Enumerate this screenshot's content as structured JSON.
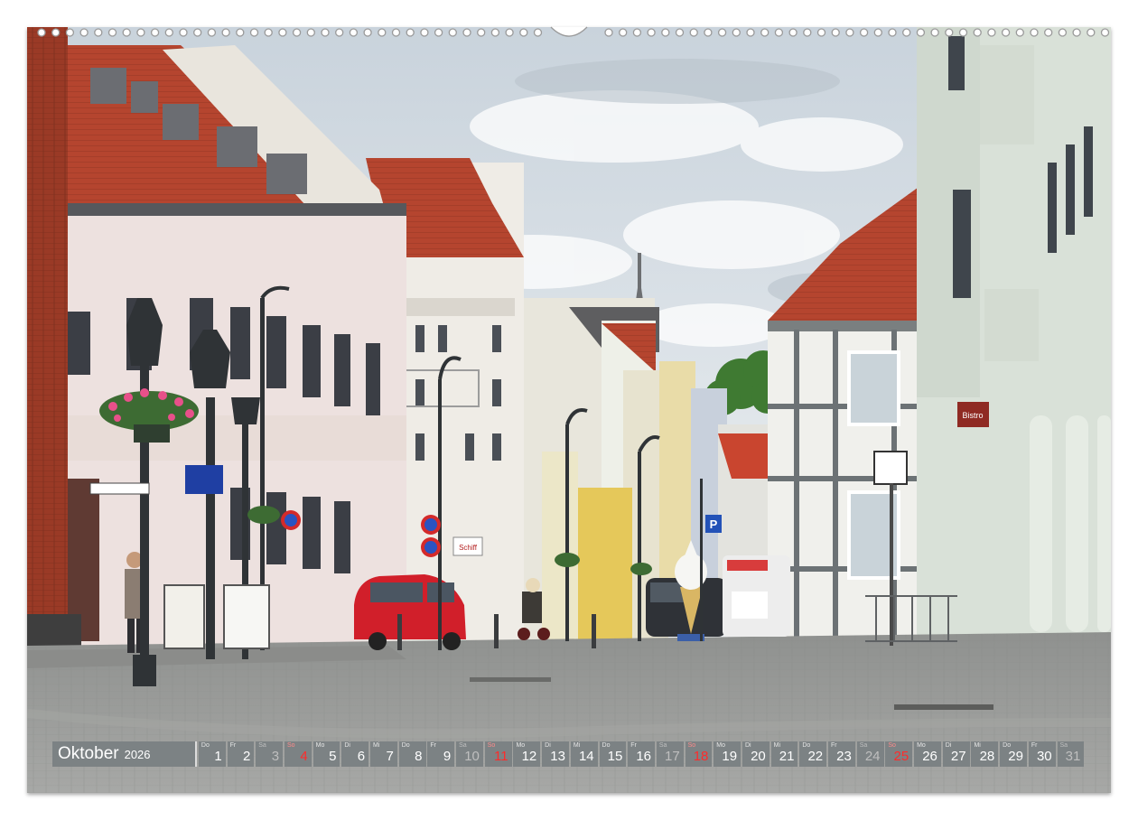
{
  "calendar": {
    "month": "Oktober",
    "year": "2026",
    "days": [
      {
        "wd": "Do",
        "n": "1",
        "kind": "weekday"
      },
      {
        "wd": "Fr",
        "n": "2",
        "kind": "weekday"
      },
      {
        "wd": "Sa",
        "n": "3",
        "kind": "sat"
      },
      {
        "wd": "So",
        "n": "4",
        "kind": "sun"
      },
      {
        "wd": "Mo",
        "n": "5",
        "kind": "weekday"
      },
      {
        "wd": "Di",
        "n": "6",
        "kind": "weekday"
      },
      {
        "wd": "Mi",
        "n": "7",
        "kind": "weekday"
      },
      {
        "wd": "Do",
        "n": "8",
        "kind": "weekday"
      },
      {
        "wd": "Fr",
        "n": "9",
        "kind": "weekday"
      },
      {
        "wd": "Sa",
        "n": "10",
        "kind": "sat"
      },
      {
        "wd": "So",
        "n": "11",
        "kind": "sun"
      },
      {
        "wd": "Mo",
        "n": "12",
        "kind": "weekday"
      },
      {
        "wd": "Di",
        "n": "13",
        "kind": "weekday"
      },
      {
        "wd": "Mi",
        "n": "14",
        "kind": "weekday"
      },
      {
        "wd": "Do",
        "n": "15",
        "kind": "weekday"
      },
      {
        "wd": "Fr",
        "n": "16",
        "kind": "weekday"
      },
      {
        "wd": "Sa",
        "n": "17",
        "kind": "sat"
      },
      {
        "wd": "So",
        "n": "18",
        "kind": "sun"
      },
      {
        "wd": "Mo",
        "n": "19",
        "kind": "weekday"
      },
      {
        "wd": "Di",
        "n": "20",
        "kind": "weekday"
      },
      {
        "wd": "Mi",
        "n": "21",
        "kind": "weekday"
      },
      {
        "wd": "Do",
        "n": "22",
        "kind": "weekday"
      },
      {
        "wd": "Fr",
        "n": "23",
        "kind": "weekday"
      },
      {
        "wd": "Sa",
        "n": "24",
        "kind": "sat"
      },
      {
        "wd": "So",
        "n": "25",
        "kind": "sun"
      },
      {
        "wd": "Mo",
        "n": "26",
        "kind": "weekday"
      },
      {
        "wd": "Di",
        "n": "27",
        "kind": "weekday"
      },
      {
        "wd": "Mi",
        "n": "28",
        "kind": "weekday"
      },
      {
        "wd": "Do",
        "n": "29",
        "kind": "weekday"
      },
      {
        "wd": "Fr",
        "n": "30",
        "kind": "weekday"
      },
      {
        "wd": "Sa",
        "n": "31",
        "kind": "sat"
      }
    ]
  },
  "photo": {
    "sign_text_cafe": "Schiff",
    "sign_text_right": "Bistro",
    "parking_sign": "P"
  },
  "colors": {
    "sky": "#dfe6ec",
    "roof_red": "#c8402c",
    "cobblestone": "#9c9d9c",
    "car_red": "#d11f2a",
    "calendar_bg": "#7c8284",
    "sunday_red": "#ff2b2b"
  }
}
